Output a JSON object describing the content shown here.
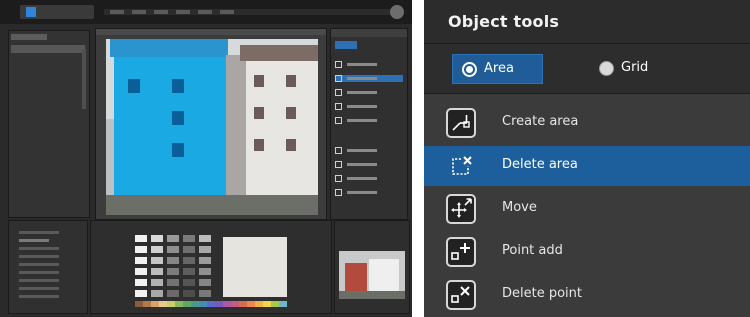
{
  "tools_panel": {
    "title": "Object tools",
    "modes": [
      {
        "label": "Area",
        "selected": true
      },
      {
        "label": "Grid",
        "selected": false
      }
    ],
    "tools": [
      {
        "label": "Create area",
        "icon": "create-area-icon"
      },
      {
        "label": "Delete area",
        "icon": "delete-area-icon",
        "selected": true
      },
      {
        "label": "Move",
        "icon": "move-icon"
      },
      {
        "label": "Point add",
        "icon": "point-add-icon"
      },
      {
        "label": "Delete point",
        "icon": "delete-point-icon"
      }
    ]
  },
  "colors": {
    "accent": "#1d5f9c",
    "selection_overlay": "#1aa9e2",
    "panel_bg": "#3b3b3b",
    "header_bg": "#2c2c2c"
  }
}
